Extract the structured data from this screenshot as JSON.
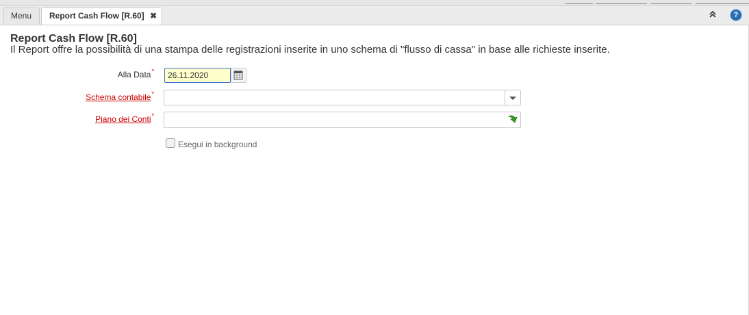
{
  "tabs": [
    {
      "label": "Menu"
    },
    {
      "label": "Report Cash Flow [R.60]",
      "close_glyph": "✖"
    }
  ],
  "toolbar": {
    "collapse_glyph": "«",
    "help_glyph": "?"
  },
  "header": {
    "title": "Report Cash Flow [R.60]",
    "description": "Il Report offre la possibilità di una stampa delle registrazioni inserite in uno schema di \"flusso di cassa\" in base alle richieste inserite."
  },
  "form": {
    "alla_data": {
      "label": "Alla Data",
      "required_mark": "*",
      "value": "26.11.2020"
    },
    "schema_contabile": {
      "label": "Schema contabile",
      "required_mark": "*",
      "value": ""
    },
    "piano_dei_conti": {
      "label": "Piano dei Conti",
      "required_mark": "*",
      "value": ""
    },
    "background": {
      "label": "Esegui in background",
      "checked": false
    }
  },
  "colors": {
    "required": "#cc0000",
    "date_bg": "#ffffcc",
    "accent": "#2a6fb6",
    "search_icon": "#3a9a2a"
  }
}
